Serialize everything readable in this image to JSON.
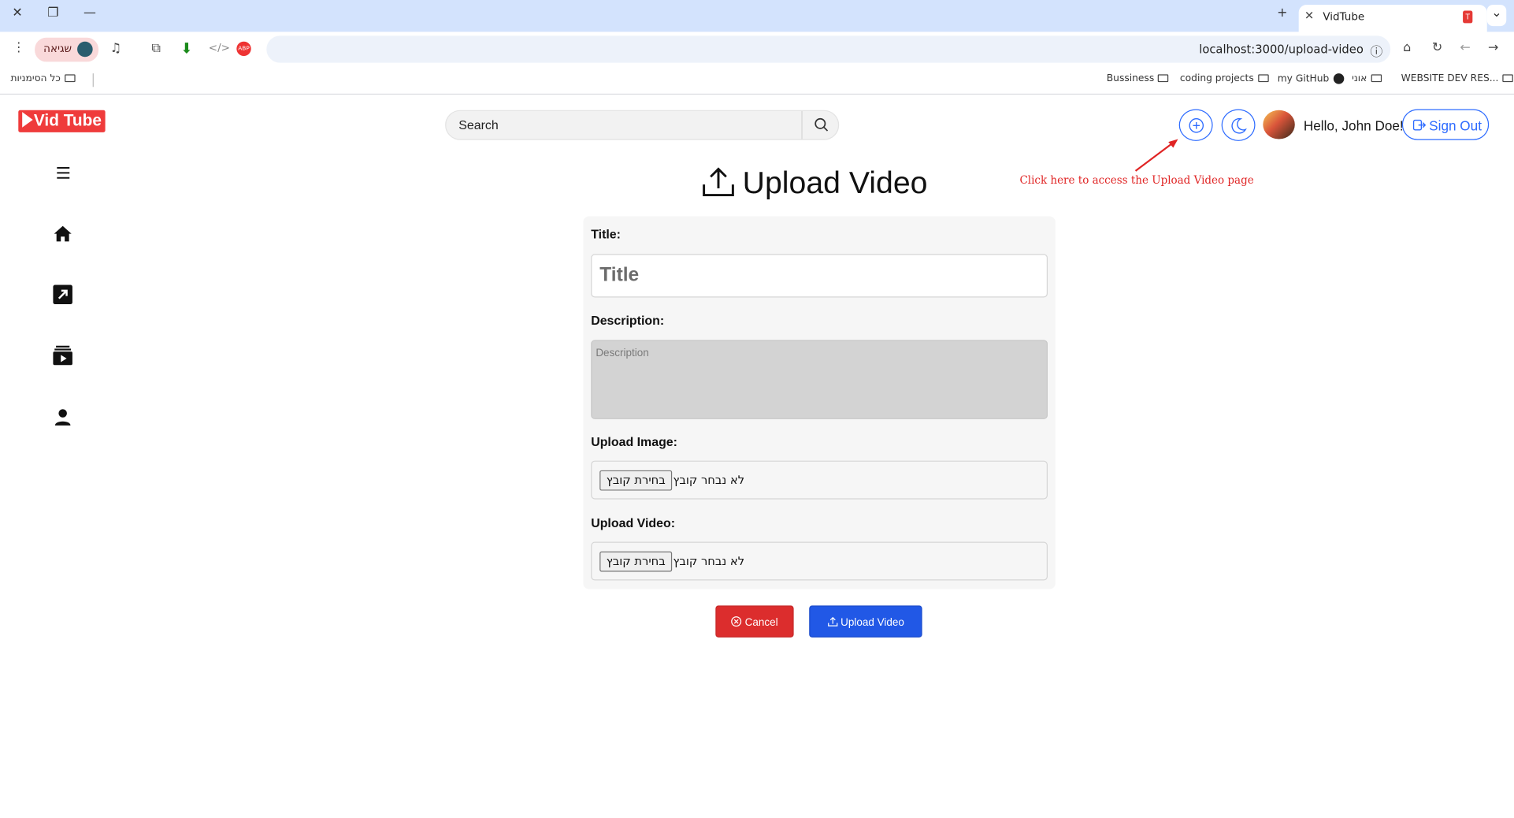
{
  "browser": {
    "tab_title": "VidTube",
    "url": "localhost:3000/upload-video",
    "profile_label": "שגיאה",
    "bookmarks": [
      "Bussiness",
      "coding projects",
      "my GitHub",
      "אוני",
      "WEBSITE DEV RES...",
      "כל הסימניות"
    ]
  },
  "app": {
    "logo_text": "Vid Tube",
    "search_placeholder": "Search",
    "greeting": "Hello, John Doe!",
    "sign_out_label": "Sign Out",
    "annotation": "Click here to access the Upload Video page",
    "page_title": "Upload Video",
    "form": {
      "title_label": "Title:",
      "title_placeholder": "Title",
      "description_label": "Description:",
      "description_placeholder": "Description",
      "image_label": "Upload Image:",
      "video_label": "Upload Video:",
      "file_button": "בחירת קובץ",
      "file_status": "לא נבחר קובץ"
    },
    "cancel_label": "Cancel",
    "upload_label": "Upload Video"
  },
  "colors": {
    "brand_red": "#ef3b3b",
    "accent_blue": "#2d6bff",
    "cancel_red": "#dc2d2d",
    "upload_blue": "#2158e6",
    "annotation_red": "#e02424"
  },
  "icons": [
    "close-icon",
    "restore-icon",
    "minimize-icon",
    "new-tab-icon",
    "tab-search-icon",
    "menu-dots-icon",
    "media-icon",
    "extensions-icon",
    "download-icon",
    "devtools-icon",
    "adblock-icon",
    "star-icon",
    "password-key-icon",
    "info-icon",
    "home-icon",
    "reload-icon",
    "back-icon",
    "forward-icon",
    "github-icon",
    "folder-icon",
    "search-icon",
    "add-circle-icon",
    "moon-icon",
    "hamburger-icon",
    "trending-icon",
    "subscriptions-icon",
    "user-icon",
    "upload-icon",
    "cancel-circle-icon",
    "sign-out-icon"
  ]
}
